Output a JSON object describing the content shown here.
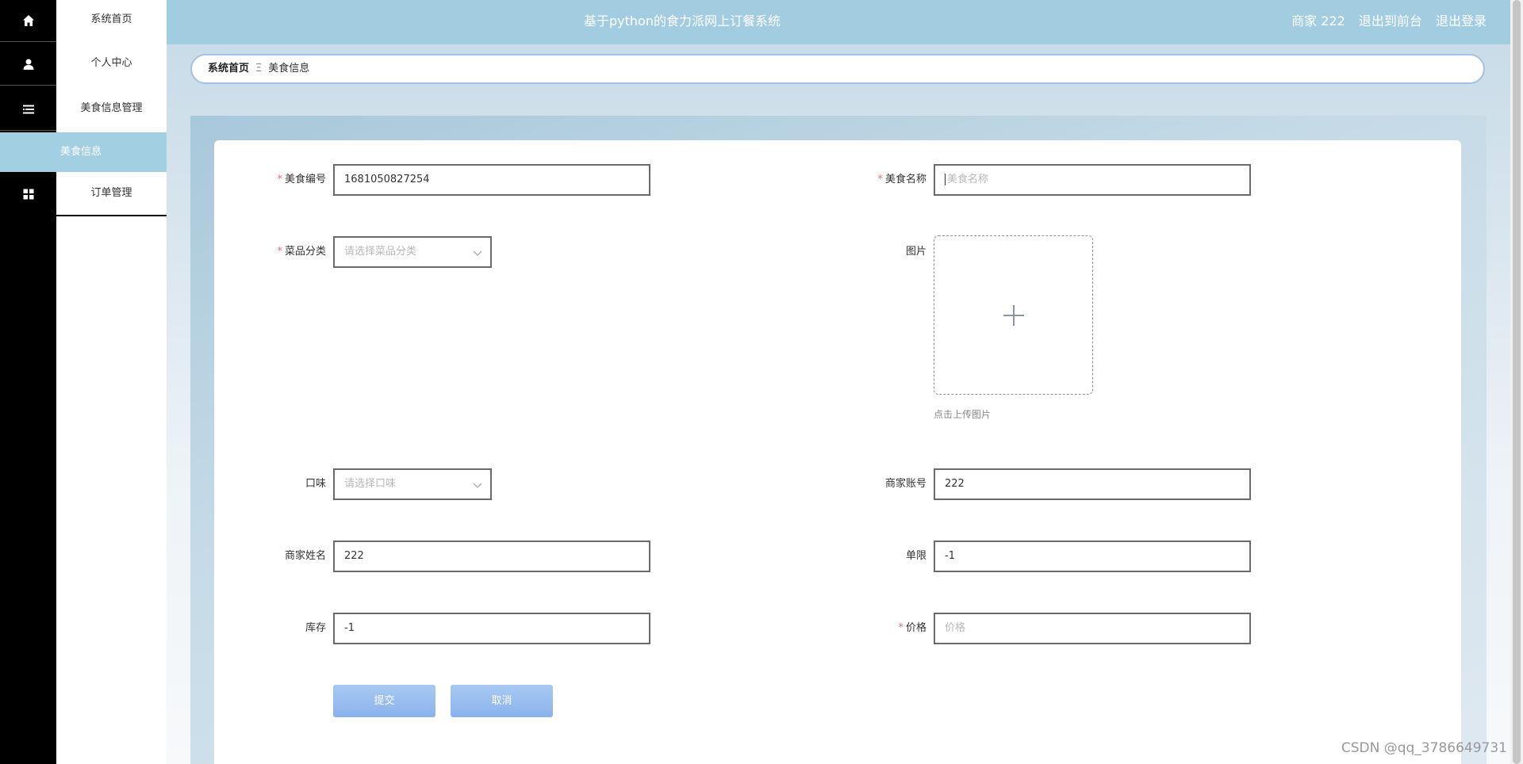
{
  "app": {
    "title": "基于python的食力派网上订餐系统"
  },
  "header": {
    "user_role": "商家 222",
    "back_to_front": "退出到前台",
    "logout": "退出登录"
  },
  "sidebar": {
    "items": [
      {
        "label": "系统首页",
        "icon": "home-icon"
      },
      {
        "label": "个人中心",
        "icon": "user-icon"
      },
      {
        "label": "美食信息管理",
        "icon": "list-icon"
      },
      {
        "label": "订单管理",
        "icon": "grid-icon"
      }
    ],
    "active_sub": "美食信息"
  },
  "breadcrumb": {
    "home": "系统首页",
    "separator": "Ξ",
    "current": "美食信息"
  },
  "form": {
    "food_no": {
      "label": "美食编号",
      "value": "1681050827254",
      "required": true
    },
    "food_name": {
      "label": "美食名称",
      "placeholder": "美食名称",
      "required": true
    },
    "category": {
      "label": "菜品分类",
      "placeholder": "请选择菜品分类",
      "required": true
    },
    "image": {
      "label": "图片",
      "hint": "点击上传图片"
    },
    "taste": {
      "label": "口味",
      "placeholder": "请选择口味"
    },
    "merchant_account": {
      "label": "商家账号",
      "value": "222"
    },
    "merchant_name": {
      "label": "商家姓名",
      "value": "222"
    },
    "limit": {
      "label": "单限",
      "value": "-1"
    },
    "stock": {
      "label": "库存",
      "value": "-1"
    },
    "price": {
      "label": "价格",
      "placeholder": "价格",
      "required": true
    },
    "submit": "提交",
    "cancel": "取消"
  },
  "watermark": "CSDN @qq_3786649731"
}
